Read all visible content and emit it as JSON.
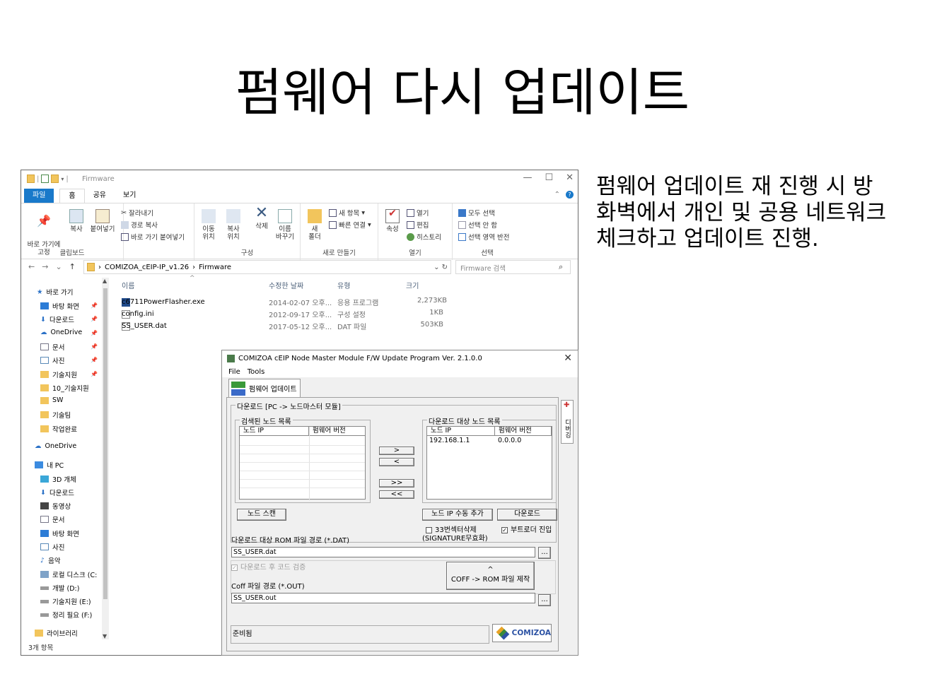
{
  "slide": {
    "title": "펌웨어 다시 업데이트",
    "side_text": "펌웨어 업데이트 재 진행 시 방화벽에서 개인 및 공용 네트워크 체크하고 업데이트 진행."
  },
  "explorer": {
    "window_title": "Firmware",
    "tabs": [
      "파일",
      "홈",
      "공유",
      "보기"
    ],
    "ribbon": {
      "pin_label": "바로 가기에\n고정",
      "copy_label": "복사",
      "paste_label": "붙여넣기",
      "cut_label": "잘라내기",
      "copy_path_label": "경로 복사",
      "paste_shortcut_label": "바로 가기 붙여넣기",
      "clipboard_group": "클립보드",
      "move_label": "이동\n위치",
      "copyto_label": "복사\n위치",
      "delete_label": "삭제",
      "rename_label": "이름\n바꾸기",
      "organize_group": "구성",
      "new_folder_label": "새\n폴더",
      "new_item_label": "새 항목",
      "easy_access_label": "빠른 연결",
      "new_group": "새로 만들기",
      "properties_label": "속성",
      "open_label": "열기",
      "edit_label": "편집",
      "history_label": "히스토리",
      "open_group": "열기",
      "select_all_label": "모두 선택",
      "select_none_label": "선택 안 함",
      "invert_label": "선택 영역 반전",
      "select_group": "선택"
    },
    "address": {
      "path": [
        "COMIZOA_cEIP-IP_v1.26",
        "Firmware"
      ],
      "search_placeholder": "Firmware 검색"
    },
    "nav": {
      "quick_access": "바로 가기",
      "items": [
        "바탕 화면",
        "다운로드",
        "OneDrive",
        "문서",
        "사진",
        "기술지원",
        "10_기술지원",
        "SW",
        "기술팀",
        "작업완료"
      ],
      "onedrive": "OneDrive",
      "this_pc": "내 PC",
      "pc_items": [
        "3D 개체",
        "다운로드",
        "동영상",
        "문서",
        "바탕 화면",
        "사진",
        "음악",
        "로컬 디스크 (C:",
        "개발 (D:)",
        "기술지원 (E:)",
        "정리 필요 (F:)"
      ],
      "libraries": "라이브러리"
    },
    "columns": [
      "이름",
      "수정한 날짜",
      "유형",
      "크기"
    ],
    "files": [
      {
        "name": "c6711PowerFlasher.exe",
        "date": "2014-02-07 오후...",
        "type": "응용 프로그램",
        "size": "2,273KB"
      },
      {
        "name": "config.ini",
        "date": "2012-09-17 오후...",
        "type": "구성 설정",
        "size": "1KB"
      },
      {
        "name": "SS_USER.dat",
        "date": "2017-05-12 오후...",
        "type": "DAT 파일",
        "size": "503KB"
      }
    ],
    "status": "3개 항목"
  },
  "dialog": {
    "title": "COMIZOA cEIP Node Master Module F/W Update Program Ver. 2.1.0.0",
    "menu": [
      "File",
      "Tools"
    ],
    "tab_label": "펌웨어 업데이트",
    "download_group": "다운로드 [PC -> 노드마스터 모듈]",
    "found_group": "검색된 노드 목록",
    "target_group": "다운로드 대상 노드 목록",
    "col_ip": "노드 IP",
    "col_fw": "펌웨어 버전",
    "target_rows": [
      {
        "ip": "192.168.1.1",
        "fw": "0.0.0.0"
      }
    ],
    "btn_right": ">",
    "btn_left": "<",
    "btn_all_right": ">>",
    "btn_all_left": "<<",
    "btn_scan": "노드 스캔",
    "btn_add_ip": "노드 IP 수동 추가",
    "btn_download": "다운로드",
    "chk_sector_erase": "33번섹터삭제",
    "chk_sector_erase_sub": "(SIGNATURE무효화)",
    "chk_bootloader": "부트로더 진입",
    "rom_path_label": "다운로드 대상 ROM 파일 경로 (*.DAT)",
    "rom_path_value": "SS_USER.dat",
    "browse": "...",
    "chk_verify": "다운로드 후 코드 검증",
    "coff_path_label": "Coff 파일 경로 (*.OUT)",
    "coff_path_value": "SS_USER.out",
    "btn_make_rom": "COFF -> ROM 파일 제작",
    "btn_make_rom_arrow": "^",
    "status": "준비됨",
    "side_tab": "디버깅",
    "logo_text": "COMIZOA"
  }
}
